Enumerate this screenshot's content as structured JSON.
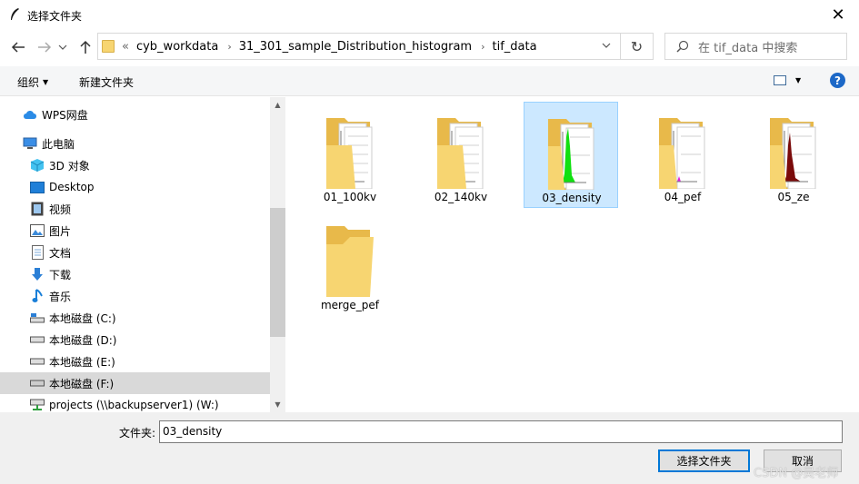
{
  "window": {
    "title": "选择文件夹",
    "close_glyph": "✕"
  },
  "address": {
    "overflow": "«",
    "segments": [
      "cyb_workdata",
      "31_301_sample_Distribution_histogram",
      "tif_data"
    ],
    "sep": "›",
    "refresh_glyph": "↻"
  },
  "search": {
    "placeholder": "在 tif_data 中搜索"
  },
  "toolbar": {
    "organize": "组织",
    "new_folder": "新建文件夹",
    "caret": "▼",
    "help": "?"
  },
  "sidebar": {
    "items": [
      {
        "label": "WPS网盘",
        "icon": "cloud-icon"
      },
      {
        "label": "此电脑",
        "icon": "computer-icon"
      },
      {
        "label": "3D 对象",
        "icon": "cube-icon"
      },
      {
        "label": "Desktop",
        "icon": "desktop-icon"
      },
      {
        "label": "视频",
        "icon": "video-icon"
      },
      {
        "label": "图片",
        "icon": "picture-icon"
      },
      {
        "label": "文档",
        "icon": "document-icon"
      },
      {
        "label": "下载",
        "icon": "download-icon"
      },
      {
        "label": "音乐",
        "icon": "music-icon"
      },
      {
        "label": "本地磁盘 (C:)",
        "icon": "drive-c-icon"
      },
      {
        "label": "本地磁盘 (D:)",
        "icon": "drive-icon"
      },
      {
        "label": "本地磁盘 (E:)",
        "icon": "drive-icon"
      },
      {
        "label": "本地磁盘 (F:)",
        "icon": "drive-icon"
      },
      {
        "label": "projects (\\\\backupserver1) (W:)",
        "icon": "network-drive-icon"
      }
    ],
    "selected": "本地磁盘 (F:)",
    "scroll_up": "▲",
    "scroll_down": "▼"
  },
  "folders": [
    {
      "name": "01_100kv",
      "thumb": "pages"
    },
    {
      "name": "02_140kv",
      "thumb": "pages"
    },
    {
      "name": "03_density",
      "thumb": "green-histogram",
      "selected": true
    },
    {
      "name": "04_pef",
      "thumb": "magenta-histogram"
    },
    {
      "name": "05_ze",
      "thumb": "darkred-histogram"
    },
    {
      "name": "merge_pef",
      "thumb": "empty"
    }
  ],
  "bottom": {
    "folder_label": "文件夹:",
    "folder_value": "03_density",
    "select_button": "选择文件夹",
    "cancel_button": "取消"
  },
  "watermark": "CSDN @吴老师"
}
